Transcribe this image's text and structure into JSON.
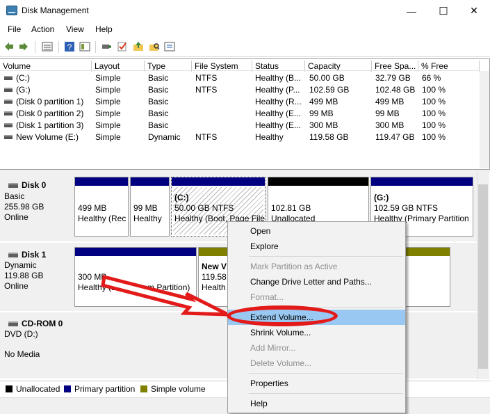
{
  "window": {
    "title": "Disk Management",
    "minimize_glyph": "—",
    "maximize_glyph": "☐",
    "close_glyph": "✕"
  },
  "menubar": [
    "File",
    "Action",
    "View",
    "Help"
  ],
  "toolbar_icons": [
    "back-icon",
    "forward-icon",
    "list-view-icon",
    "help-icon",
    "details-icon",
    "connect-icon",
    "check-icon",
    "up-folder-icon",
    "search-folder-icon",
    "properties-icon"
  ],
  "table": {
    "headers": [
      "Volume",
      "Layout",
      "Type",
      "File System",
      "Status",
      "Capacity",
      "Free Spa...",
      "% Free"
    ],
    "rows": [
      [
        "(C:)",
        "Simple",
        "Basic",
        "NTFS",
        "Healthy (B...",
        "50.00 GB",
        "32.79 GB",
        "66 %"
      ],
      [
        "(G:)",
        "Simple",
        "Basic",
        "NTFS",
        "Healthy (P...",
        "102.59 GB",
        "102.48 GB",
        "100 %"
      ],
      [
        "(Disk 0 partition 1)",
        "Simple",
        "Basic",
        "",
        "Healthy (R...",
        "499 MB",
        "499 MB",
        "100 %"
      ],
      [
        "(Disk 0 partition 2)",
        "Simple",
        "Basic",
        "",
        "Healthy (E...",
        "99 MB",
        "99 MB",
        "100 %"
      ],
      [
        "(Disk 1 partition 3)",
        "Simple",
        "Basic",
        "",
        "Healthy (E...",
        "300 MB",
        "300 MB",
        "100 %"
      ],
      [
        "New Volume (E:)",
        "Simple",
        "Dynamic",
        "NTFS",
        "Healthy",
        "119.58 GB",
        "119.47 GB",
        "100 %"
      ]
    ]
  },
  "disks": {
    "disk0": {
      "name": "Disk 0",
      "type": "Basic",
      "size": "255.98 GB",
      "status": "Online",
      "partitions": [
        {
          "line1": "499 MB",
          "line2": "Healthy (Rec"
        },
        {
          "line1": "99 MB",
          "line2": "Healthy"
        },
        {
          "title": "(C:)",
          "line1": "50.00 GB NTFS",
          "line2": "Healthy (Boot, Page File"
        },
        {
          "line1": "102.81 GB",
          "line2": "Unallocated"
        },
        {
          "title": "(G:)",
          "line1": "102.59 GB NTFS",
          "line2": "Healthy (Primary Partition"
        }
      ]
    },
    "disk1": {
      "name": "Disk 1",
      "type": "Dynamic",
      "size": "119.88 GB",
      "status": "Online",
      "partitions": [
        {
          "line1": "300 MB",
          "line2": "Healthy (EFI System Partition)"
        },
        {
          "title": "New V",
          "line1": "119.58",
          "line2": "Health"
        }
      ]
    },
    "cdrom0": {
      "name": "CD-ROM 0",
      "type": "DVD (D:)",
      "status": "No Media"
    }
  },
  "legend": [
    {
      "label": "Unallocated",
      "color": "#000000"
    },
    {
      "label": "Primary partition",
      "color": "#000080"
    },
    {
      "label": "Simple volume",
      "color": "#808000"
    }
  ],
  "context_menu": {
    "open": "Open",
    "explore": "Explore",
    "mark_active": "Mark Partition as Active",
    "change_letter": "Change Drive Letter and Paths...",
    "format": "Format...",
    "extend": "Extend Volume...",
    "shrink": "Shrink Volume...",
    "add_mirror": "Add Mirror...",
    "delete": "Delete Volume...",
    "properties": "Properties",
    "help": "Help"
  },
  "colors": {
    "primary_partition": "#000080",
    "simple_volume": "#808000",
    "unallocated": "#000000",
    "highlight": "#99c9f2",
    "annotation_red": "#e31a1a"
  }
}
